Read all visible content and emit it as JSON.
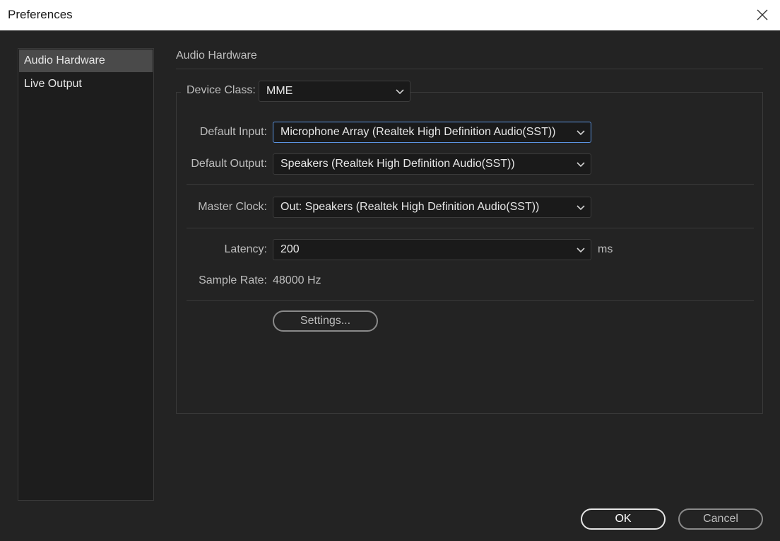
{
  "window": {
    "title": "Preferences"
  },
  "sidebar": {
    "items": [
      {
        "label": "Audio Hardware",
        "selected": true
      },
      {
        "label": "Live Output",
        "selected": false
      }
    ]
  },
  "panel": {
    "title": "Audio Hardware",
    "device_class": {
      "label": "Device Class:",
      "value": "MME"
    },
    "default_input": {
      "label": "Default Input:",
      "value": "Microphone Array (Realtek High Definition Audio(SST))"
    },
    "default_output": {
      "label": "Default Output:",
      "value": "Speakers (Realtek High Definition Audio(SST))"
    },
    "master_clock": {
      "label": "Master Clock:",
      "value": "Out: Speakers (Realtek High Definition Audio(SST))"
    },
    "latency": {
      "label": "Latency:",
      "value": "200",
      "unit": "ms"
    },
    "sample_rate": {
      "label": "Sample Rate:",
      "value": "48000 Hz"
    },
    "settings_button": "Settings..."
  },
  "footer": {
    "ok_label": "OK",
    "cancel_label": "Cancel"
  },
  "colors": {
    "background": "#232323",
    "focus": "#5b93e0",
    "titlebar": "#ffffff"
  }
}
